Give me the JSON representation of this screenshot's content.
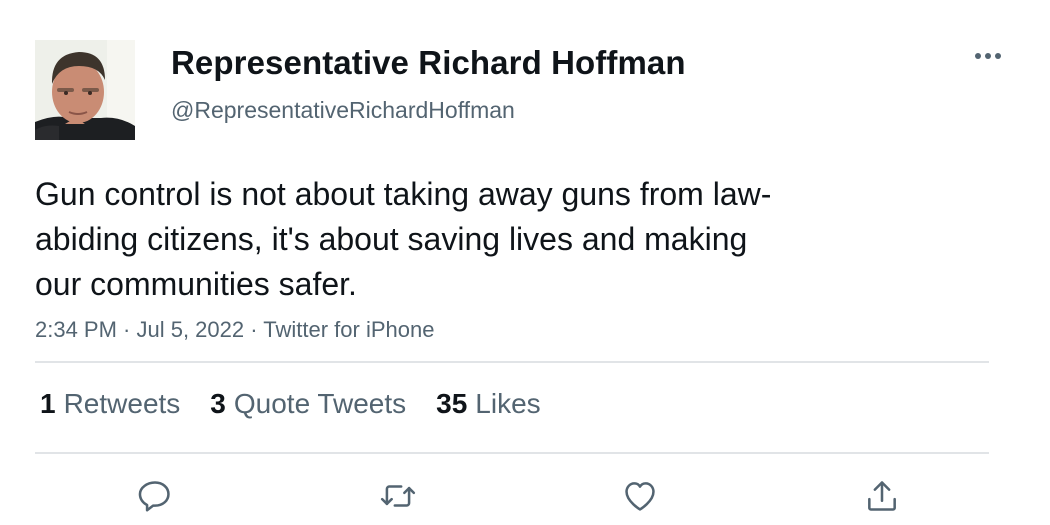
{
  "author": {
    "display_name": "Representative Richard Hoffman",
    "handle": "@RepresentativeRichardHoffman"
  },
  "tweet": {
    "text": "Gun control is not about taking away guns from law-\nabiding citizens, it's about saving lives and making\nour communities safer.",
    "meta": "2:34 PM · Jul 5, 2022 · Twitter for iPhone"
  },
  "stats": [
    {
      "count": "1",
      "label": "Retweets"
    },
    {
      "count": "3",
      "label": "Quote Tweets"
    },
    {
      "count": "35",
      "label": "Likes"
    }
  ],
  "icons": {
    "more": "more-icon",
    "reply": "reply-icon",
    "retweet": "retweet-icon",
    "like": "heart-icon",
    "share": "share-icon"
  },
  "colors": {
    "text_primary": "#0f1419",
    "text_secondary": "#536471",
    "divider": "#e1e4e7"
  }
}
